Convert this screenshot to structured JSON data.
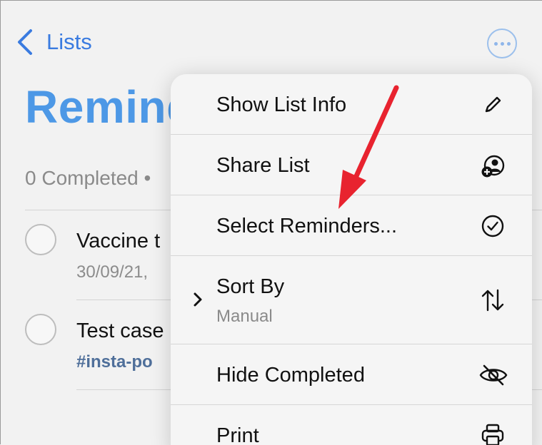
{
  "nav": {
    "back_label": "Lists"
  },
  "list": {
    "title": "Remind",
    "completed_text": "0 Completed •"
  },
  "reminders": [
    {
      "title": "Vaccine t",
      "subtitle": "30/09/21,"
    },
    {
      "title": "Test case",
      "tag": "#insta-po"
    }
  ],
  "menu": {
    "items": [
      {
        "label": "Show List Info",
        "icon": "pencil-icon"
      },
      {
        "label": "Share List",
        "icon": "share-person-icon"
      },
      {
        "label": "Select Reminders...",
        "icon": "checkmark-circle-icon"
      },
      {
        "label": "Sort By",
        "sublabel": "Manual",
        "icon": "sort-arrows-icon"
      },
      {
        "label": "Hide Completed",
        "icon": "eye-slash-icon"
      },
      {
        "label": "Print",
        "icon": "printer-icon"
      }
    ]
  },
  "colors": {
    "accent": "#3a7be0",
    "title_blue": "#4d98e6",
    "arrow_red": "#e8232f"
  }
}
